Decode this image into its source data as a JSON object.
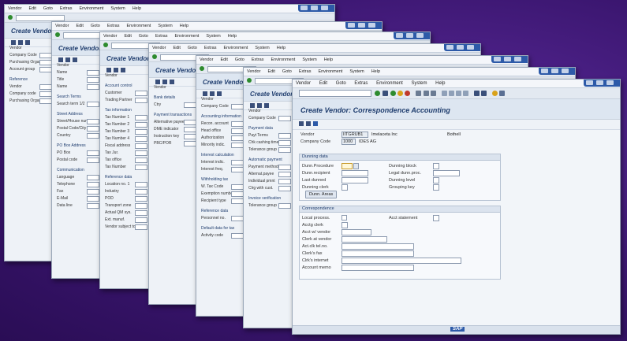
{
  "menu": [
    "Vendor",
    "Edit",
    "Goto",
    "Extras",
    "Environment",
    "System",
    "Help"
  ],
  "back_windows": [
    {
      "title": "Create Vendor",
      "labels": [
        "Vendor",
        "Company Code",
        "Purchasing Organization",
        "Account group",
        "Reference",
        "Vendor",
        "Company code",
        "Purchasing Organization"
      ]
    },
    {
      "title": "Create Vendor",
      "labels": [
        "Vendor",
        "Name",
        "Title",
        "Name",
        "Search Terms",
        "Search term 1/2",
        "Street Address",
        "Street/House number",
        "Postal Code/City",
        "Country",
        "PO Box Address",
        "PO Box",
        "Postal code",
        "Communication",
        "Language",
        "Telephone",
        "Fax",
        "E-Mail",
        "Data line"
      ]
    },
    {
      "title": "Create Vendor",
      "labels": [
        "Vendor",
        "Account control",
        "Customer",
        "Trading Partner",
        "Tax information",
        "Tax Number 1",
        "Tax Number 2",
        "Tax Number 3",
        "Tax Number 4",
        "Fiscal address",
        "Tax Jur.",
        "Tax office",
        "Tax Number",
        "Reference data",
        "Location no. 1",
        "Industry",
        "POD",
        "Transport zone",
        "Actual QM sys.",
        "Ext. manuf.",
        "Vendor subject to"
      ]
    },
    {
      "title": "Create Vendor",
      "labels": [
        "Vendor",
        "Bank details",
        "Ctry",
        "Payment transactions",
        "Alternative payee",
        "DME indicator",
        "Instruction key",
        "PBC/POR"
      ]
    },
    {
      "title": "Create Vendor",
      "labels": [
        "Vendor",
        "Company Code",
        "Accounting information",
        "Recon. account",
        "Head office",
        "Authorization",
        "Minority indic.",
        "Interest calculation",
        "Interest indic.",
        "Interest freq.",
        "Withholding tax",
        "W. Tax Code",
        "Exemption number",
        "Recipient type",
        "Reference data",
        "Personnel no.",
        "Default data for tax",
        "Activity code"
      ]
    },
    {
      "title": "Create Vendor",
      "labels": [
        "Vendor",
        "Company Code",
        "Payment data",
        "Payt Terms",
        "Chk cashing time",
        "Tolerance group",
        "Automatic payment",
        "Payment methods",
        "Alternat.payee",
        "Individual pmnt",
        "Clrg with cust.",
        "Invoice verification",
        "Tolerance group"
      ]
    }
  ],
  "front": {
    "title": "Create Vendor: Correspondence Accounting",
    "vendor_label": "Vendor",
    "vendor_value": "IITGRUB1",
    "vendor_name": "Imelaceta Inc",
    "vendor_city": "Bothell",
    "company_code_label": "Company Code",
    "company_code_value": "1000",
    "company_code_name": "IDES AG",
    "dunning": {
      "header": "Dunning data",
      "left": [
        "Dunn.Procedure",
        "Dunn.recipient",
        "Last dunned",
        "Dunning clerk"
      ],
      "right": [
        "Dunning block",
        "Legal dunn.proc.",
        "Dunning level",
        "Grouping key"
      ],
      "button": "Dunn. Areas"
    },
    "corr": {
      "header": "Correspondence",
      "fields": [
        "Local process.",
        "Acctg clerk",
        "Acct w/ vendor",
        "Clerk at vendor",
        "Act.clk tel.no.",
        "Clerk's fax",
        "Clrk's internet",
        "Account memo"
      ],
      "right": "Acct statement"
    }
  }
}
